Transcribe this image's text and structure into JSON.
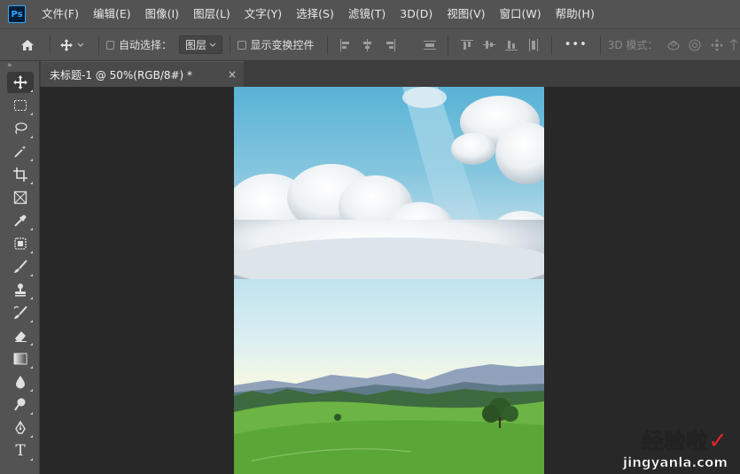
{
  "app": {
    "logo": "Ps"
  },
  "menu": [
    "文件(F)",
    "编辑(E)",
    "图像(I)",
    "图层(L)",
    "文字(Y)",
    "选择(S)",
    "滤镜(T)",
    "3D(D)",
    "视图(V)",
    "窗口(W)",
    "帮助(H)"
  ],
  "options": {
    "auto_select_label": "自动选择：",
    "auto_select_checked": false,
    "layer_select_value": "图层",
    "show_transform_label": "显示变换控件",
    "show_transform_checked": false,
    "more": "•••",
    "mode_3d_label": "3D 模式："
  },
  "document": {
    "tab_title": "未标题-1 @ 50%(RGB/8#) *",
    "close_glyph": "×"
  },
  "toolbar": {
    "grip": "»",
    "tools": [
      "move-tool",
      "rectangular-marquee-tool",
      "lasso-tool",
      "magic-wand-tool",
      "crop-tool",
      "frame-tool",
      "eyedropper-tool",
      "patch-tool",
      "brush-tool",
      "clone-stamp-tool",
      "history-brush-tool",
      "eraser-tool",
      "gradient-tool",
      "blur-tool",
      "dodge-tool",
      "pen-tool",
      "type-tool"
    ],
    "type_glyph": "T"
  },
  "watermark": {
    "text_cn": "经验啦",
    "check": "✓",
    "text_en": "jingyanla.com"
  },
  "colors": {
    "ui_bg": "#535353",
    "canvas_bg": "#282828",
    "ps_blue": "#31a8ff"
  }
}
